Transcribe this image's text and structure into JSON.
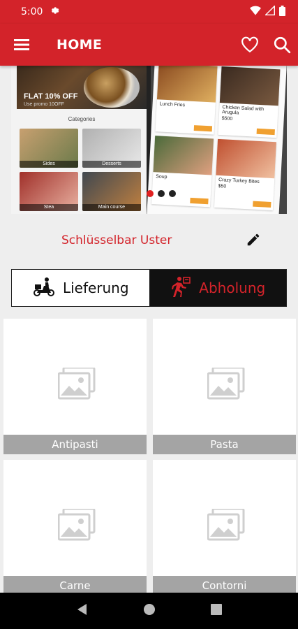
{
  "status_bar": {
    "time": "5:00"
  },
  "app_bar": {
    "title": "HOME",
    "menu_icon": "menu-icon",
    "favorite_icon": "heart-icon",
    "search_icon": "search-icon"
  },
  "banner": {
    "promo_headline": "FLAT 10% OFF",
    "promo_sub": "Use promo 10OFF",
    "categories_title": "Categories",
    "categories": [
      "Sides",
      "Desserts",
      "Stea",
      "Main course"
    ],
    "dishes": [
      {
        "name": "Lunch Fries",
        "price": ""
      },
      {
        "name": "Chicken Salad with Arugula",
        "price": "$500"
      },
      {
        "name": "Soup",
        "price": ""
      },
      {
        "name": "Crazy Turkey Bites",
        "price": "$50"
      }
    ]
  },
  "store": {
    "name": "Schlüsselbar Uster",
    "edit_icon": "pencil-icon"
  },
  "order_mode": {
    "delivery_label": "Lieferung",
    "pickup_label": "Abholung",
    "selected": "pickup"
  },
  "categories": [
    {
      "label": "Antipasti"
    },
    {
      "label": "Pasta"
    },
    {
      "label": "Carne"
    },
    {
      "label": "Contorni"
    }
  ],
  "colors": {
    "accent": "#d3232a",
    "dark": "#111111",
    "card_label_bg": "#a4a4a4"
  }
}
